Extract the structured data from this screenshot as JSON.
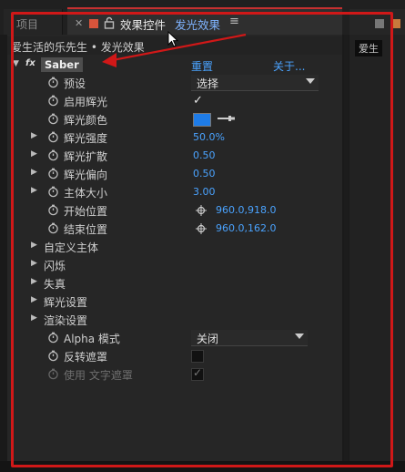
{
  "tabs": {
    "project_label": "项目",
    "effect_controls_label": "效果控件",
    "effect_controls_sub": "发光效果",
    "menu_glyph": "≡"
  },
  "side_panel": {
    "label": "爱生"
  },
  "breadcrumb": "爱生活的乐先生 • 发光效果",
  "effect": {
    "fx_glyph": "fx",
    "name": "Saber",
    "reset": "重置",
    "about": "关于..."
  },
  "rows": [
    {
      "label": "预设",
      "value": "选择",
      "kind": "dropdown"
    },
    {
      "label": "启用辉光",
      "value": "✓",
      "kind": "check"
    },
    {
      "label": "辉光颜色",
      "kind": "color",
      "color": "#1e7ce8"
    },
    {
      "label": "辉光强度",
      "value": "50.0%",
      "kind": "number"
    },
    {
      "label": "辉光扩散",
      "value": "0.50",
      "kind": "number"
    },
    {
      "label": "辉光偏向",
      "value": "0.50",
      "kind": "number"
    },
    {
      "label": "主体大小",
      "value": "3.00",
      "kind": "number"
    },
    {
      "label": "开始位置",
      "value": "960.0,918.0",
      "kind": "point"
    },
    {
      "label": "结束位置",
      "value": "960.0,162.0",
      "kind": "point"
    }
  ],
  "groups": [
    "自定义主体",
    "闪烁",
    "失真",
    "辉光设置",
    "渲染设置"
  ],
  "bottom_rows": [
    {
      "label": "Alpha 模式",
      "value": "关闭",
      "kind": "dropdown"
    },
    {
      "label": "反转遮罩",
      "kind": "checkbox"
    },
    {
      "label": "使用 文字遮罩",
      "value": "✓",
      "kind": "checkbox-dim"
    }
  ],
  "colors": {
    "accent_blue": "#4aa3ff",
    "annotation_red": "#d01818",
    "tab_accent": "#c73030"
  }
}
